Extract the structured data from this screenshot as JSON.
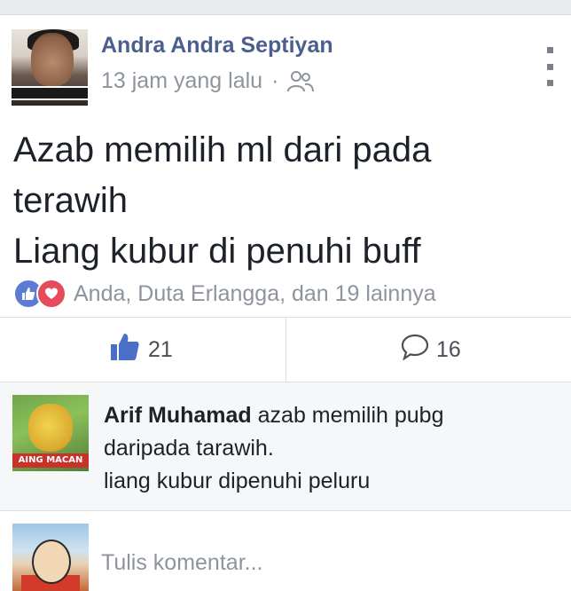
{
  "post": {
    "author": "Andra Andra Septiyan",
    "time": "13 jam yang lalu",
    "separator": "·",
    "text_lines": [
      "Azab memilih ml dari pada",
      "terawih",
      "Liang kubur di penuhi buff"
    ],
    "reactions_summary": "Anda, Duta Erlangga, dan 19 lainnya",
    "reaction_icons": [
      "like-icon",
      "love-icon"
    ],
    "privacy_icon": "friends-icon",
    "menu_icon": "more-vertical-icon"
  },
  "actions": {
    "like_count": "21",
    "comment_count": "16"
  },
  "comment": {
    "author": "Arif Muhamad",
    "text_line1": " azab memilih pubg",
    "text_line2": "daripada tarawih.",
    "text_line3": "liang kubur dipenuhi peluru",
    "avatar_tag": "AING MACAN"
  },
  "composer": {
    "placeholder": "Tulis komentar..."
  },
  "colors": {
    "author_blue": "#4b5f8e",
    "meta_gray": "#8d949e",
    "like_blue": "#5b7bd5",
    "love_red": "#e44b5b"
  }
}
